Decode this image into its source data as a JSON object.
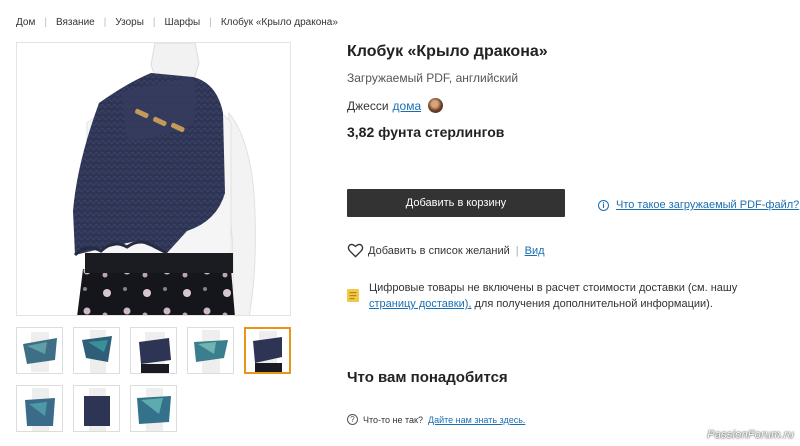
{
  "breadcrumb": [
    "Дом",
    "Вязание",
    "Узоры",
    "Шарфы",
    "Клобук «Крыло дракона»"
  ],
  "product": {
    "title": "Клобук «Крыло дракона»",
    "subtitle": "Загружаемый PDF, английский",
    "designer_name": "Джесси",
    "designer_link": "дома",
    "price": "3,82 фунта стерлингов"
  },
  "actions": {
    "add_to_cart": "Добавить в корзину",
    "pdf_info": "Что такое загружаемый PDF-файл?",
    "wishlist": "Добавить в список желаний",
    "view": "Вид"
  },
  "shipping": {
    "text_before": "Цифровые товары не включены в расчет стоимости доставки (см. нашу ",
    "link": "страницу доставки),",
    "text_after": " для получения дополнительной информации)."
  },
  "needs": {
    "heading": "Что вам понадобится",
    "question": "Что-то не так?",
    "question_link": "Дайте нам знать здесь."
  },
  "thumbnails": {
    "count": 8,
    "active_index": 4
  },
  "watermark": "PassionForum.ru",
  "colors": {
    "accent_link": "#1a6fb3",
    "button_bg": "#333333",
    "active_thumb_border": "#e8961a",
    "garment": "#2c3250"
  }
}
